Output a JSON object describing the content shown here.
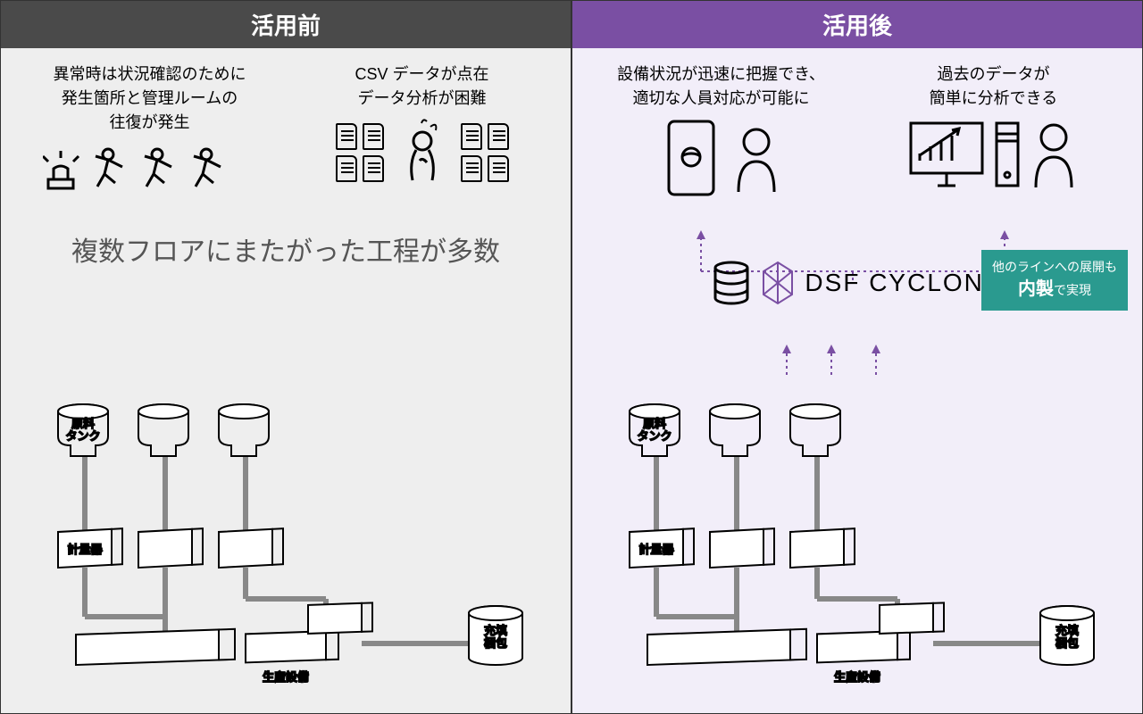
{
  "left": {
    "header": "活用前",
    "block1": {
      "line1": "異常時は状況確認のために",
      "line2": "発生箇所と管理ルームの",
      "line3": "往復が発生"
    },
    "block2": {
      "line1": "CSV データが点在",
      "line2": "データ分析が困難"
    },
    "big": "複数フロアにまたがった工程が多数"
  },
  "right": {
    "header": "活用後",
    "block1": {
      "line1": "設備状況が迅速に把握でき、",
      "line2": "適切な人員対応が可能に"
    },
    "block2": {
      "line1": "過去のデータが",
      "line2": "簡単に分析できる"
    },
    "product": "DSF CYCLONE",
    "callout": {
      "line1": "他のラインへの展開も",
      "big": "内製",
      "suffix": "で実現"
    }
  },
  "factory": {
    "tank_label1": "原料",
    "tank_label2": "タンク",
    "scale_label": "計量器",
    "equip_label": "生産設備",
    "fill_label1": "充填",
    "fill_label2": "梱包"
  }
}
